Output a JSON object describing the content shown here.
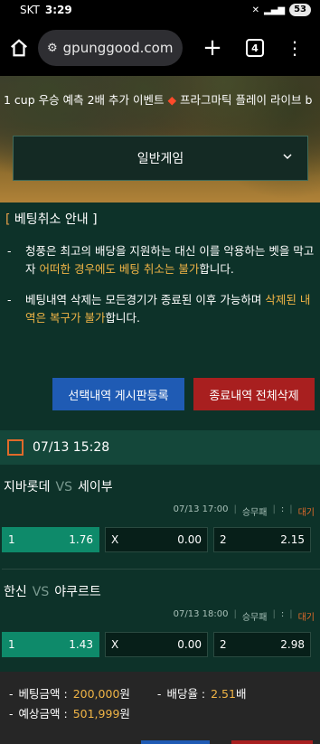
{
  "status": {
    "carrier": "SKT",
    "time": "3:29",
    "battery": "53"
  },
  "browser": {
    "url": "gpunggood.com",
    "tab_count": "4"
  },
  "banner": {
    "marquee": "1 cup 우승 예측 2배 추가 이벤트 ",
    "marquee2": " 프라그마틱 플레이 라이브 b",
    "game_select": "일반게임"
  },
  "notice": {
    "title": "베팅취소 안내",
    "items": [
      {
        "text1": "청풍은 최고의 배당을 지원하는 대신 이를 악용하는 벳을 막고자 ",
        "hl": "어떠한 경우에도 베팅 취소는 불가",
        "text2": "합니다."
      },
      {
        "text1": "베팅내역 삭제는 모든경기가 종료된 이후 가능하며 ",
        "hl": "삭제된 내역은 복구가 불가",
        "text2": "합니다."
      }
    ]
  },
  "buttons": {
    "post_board": "선택내역 게시판등록",
    "delete_all": "종료내역 전체삭제"
  },
  "date_group": "07/13 15:28",
  "matches": [
    {
      "home": "지바롯데",
      "vs": "VS",
      "away": "세이부",
      "time": "07/13 17:00",
      "market": "승무패",
      "colon": ":",
      "status": "대기",
      "odds": [
        {
          "label": "1",
          "value": "1.76"
        },
        {
          "label": "X",
          "value": "0.00"
        },
        {
          "label": "2",
          "value": "2.15"
        }
      ]
    },
    {
      "home": "한신",
      "vs": "VS",
      "away": "야쿠르트",
      "time": "07/13 18:00",
      "market": "승무패",
      "colon": ":",
      "status": "대기",
      "odds": [
        {
          "label": "1",
          "value": "1.43"
        },
        {
          "label": "X",
          "value": "0.00"
        },
        {
          "label": "2",
          "value": "2.98"
        }
      ]
    }
  ],
  "summary": {
    "bet_label": "베팅금액 :",
    "bet_value": "200,000",
    "bet_unit": "원",
    "rate_label": "배당율 :",
    "rate_value": "2.51",
    "rate_unit": "배",
    "expect_label": "예상금액 :",
    "expect_value": "501,999",
    "expect_unit": "원"
  },
  "colors": {
    "accent": "#0e8a6a",
    "highlight": "#f0b446",
    "blue": "#1f5bb4",
    "red": "#a81f1f"
  }
}
